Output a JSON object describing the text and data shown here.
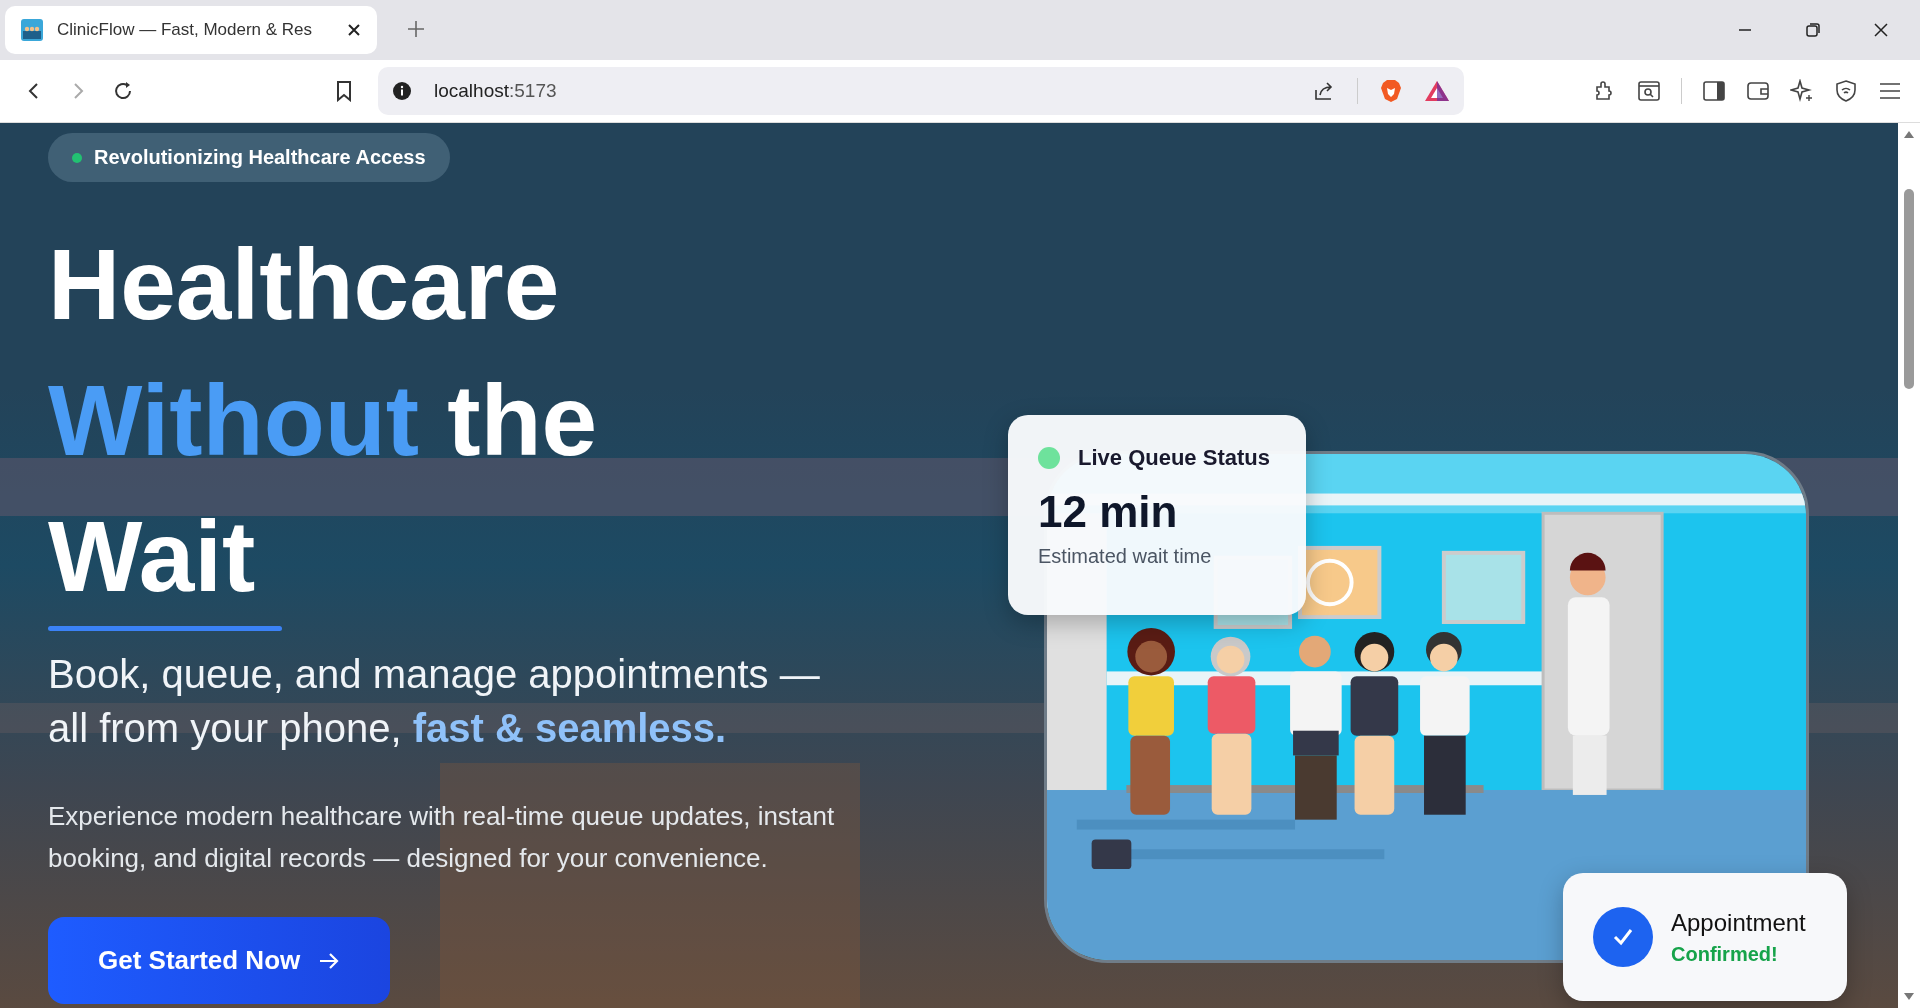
{
  "browser": {
    "tab": {
      "title": "ClinicFlow — Fast, Modern & Res",
      "selected": true
    },
    "address": {
      "host": "localhost",
      "port": ":5173"
    }
  },
  "hero": {
    "badge": {
      "text": "Revolutionizing Healthcare Access",
      "live": true
    },
    "title_lines": [
      [
        {
          "text": "Healthcare",
          "highlight": false
        }
      ],
      [
        {
          "text": "Without",
          "highlight": true
        },
        {
          "text": "the",
          "highlight": false
        }
      ],
      [
        {
          "text": "Wait",
          "highlight": false
        }
      ]
    ],
    "subtitle": "Book, queue, and manage appointments — all from your phone, **fast & seamless.**",
    "description": "Experience modern healthcare with real-time queue updates, instant booking, and digital records — designed for your convenience.",
    "cta": "Get Started Now"
  },
  "queue_card": {
    "title": "Live Queue Status",
    "live": true,
    "value": "12 min",
    "caption": "Estimated wait time"
  },
  "appointment_card": {
    "title": "Appointment",
    "status": "Confirmed!",
    "confirmed": true
  }
}
